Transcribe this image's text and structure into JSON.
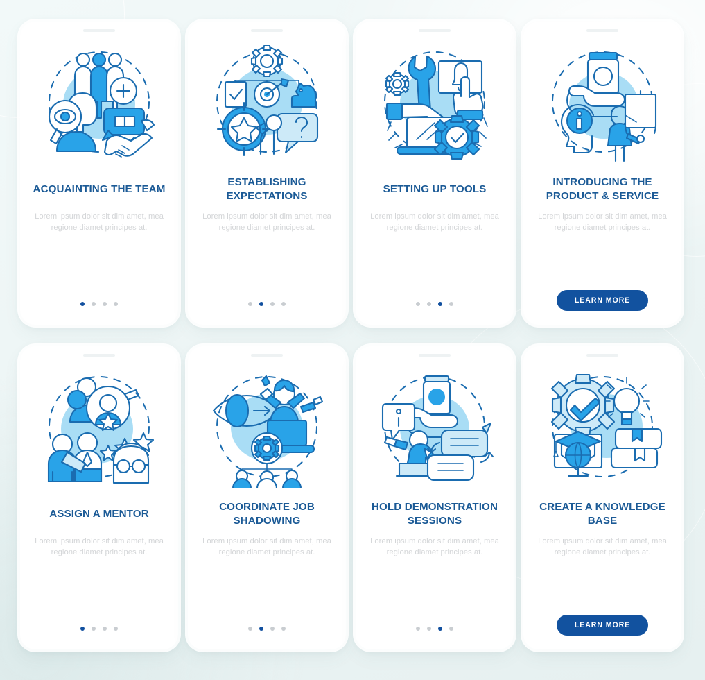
{
  "meta": {
    "kind": "onboarding-screens-set",
    "card_count": 8,
    "colors": {
      "title": "#1b5a96",
      "body": "#d4d6d8",
      "cta_bg": "#12529f",
      "cta_text": "#ffffff",
      "dot_active": "#12509f",
      "dot_inactive": "#c9cdd1",
      "illustration_outline": "#1a6cb0",
      "illustration_fill": "#29a3e8",
      "illustration_pale": "#cdeaf8",
      "illustration_blob": "#a9ddf5",
      "card_bg": "#ffffff",
      "page_bg": "#edf5f5"
    }
  },
  "shared": {
    "body_text": "Lorem ipsum dolor sit dim amet, mea regione diamet principes at.",
    "cta_label": "LEARN MORE",
    "dot_total": 4
  },
  "cards": [
    {
      "id": "acquainting-the-team",
      "title": "ACQUAINTING THE TEAM",
      "body": "Lorem ipsum dolor sit dim amet, mea regione diamet principes at.",
      "footer": "dots",
      "active_dot": 1,
      "illustration": "team-people-handshake-eye-icon"
    },
    {
      "id": "establishing-expectations",
      "title": "ESTABLISHING EXPECTATIONS",
      "body": "Lorem ipsum dolor sit dim amet, mea regione diamet principes at.",
      "footer": "dots",
      "active_dot": 2,
      "illustration": "target-gear-checklist-question-icon"
    },
    {
      "id": "setting-up-tools",
      "title": "SETTING UP TOOLS",
      "body": "Lorem ipsum dolor sit dim amet, mea regione diamet principes at.",
      "footer": "dots",
      "active_dot": 3,
      "illustration": "wrench-gear-laptop-notification-icon"
    },
    {
      "id": "introducing-the-product-and-service",
      "title": "INTRODUCING THE PRODUCT & SERVICE",
      "body": "Lorem ipsum dolor sit dim amet, mea regione diamet principes at.",
      "footer": "button",
      "cta_label": "LEARN MORE",
      "illustration": "product-hand-info-head-presenter-icon"
    },
    {
      "id": "assign-a-mentor",
      "title": "ASSIGN A MENTOR",
      "body": "Lorem ipsum dolor sit dim amet, mea regione diamet principes at.",
      "footer": "dots",
      "active_dot": 1,
      "illustration": "people-magnifier-stars-mentor-icon"
    },
    {
      "id": "coordinate-job-shadowing",
      "title": "COORDINATE JOB SHADOWING",
      "body": "Lorem ipsum dolor sit dim amet, mea regione diamet principes at.",
      "footer": "dots",
      "active_dot": 2,
      "illustration": "eye-arrow-multitask-org-chart-icon"
    },
    {
      "id": "hold-demonstration-sessions",
      "title": "HOLD DEMONSTRATION SESSIONS",
      "body": "Lorem ipsum dolor sit dim amet, mea regione diamet principes at.",
      "footer": "dots",
      "active_dot": 3,
      "illustration": "presenter-product-speech-bubbles-icon"
    },
    {
      "id": "create-a-knowledge-base",
      "title": "CREATE A KNOWLEDGE BASE",
      "body": "Lorem ipsum dolor sit dim amet, mea regione diamet principes at.",
      "footer": "button",
      "cta_label": "LEARN MORE",
      "illustration": "gear-check-bulb-books-monitor-icon"
    }
  ]
}
